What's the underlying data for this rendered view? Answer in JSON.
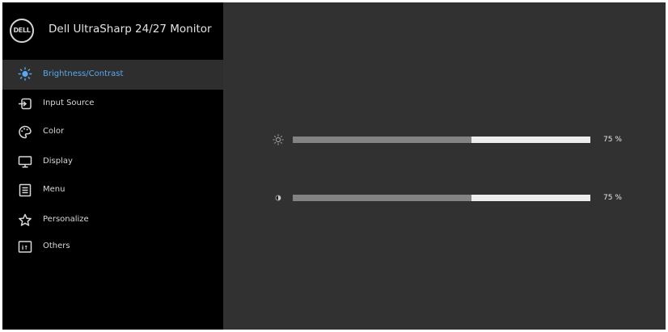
{
  "header": {
    "logo_text": "DELL",
    "title": "Dell UltraSharp 24/27 Monitor"
  },
  "menu": {
    "items": [
      {
        "label": "Brightness/Contrast",
        "icon": "brightness-icon",
        "active": true
      },
      {
        "label": "Input Source",
        "icon": "input-source-icon",
        "active": false
      },
      {
        "label": "Color",
        "icon": "color-palette-icon",
        "active": false
      },
      {
        "label": "Display",
        "icon": "display-icon",
        "active": false
      },
      {
        "label": "Menu",
        "icon": "menu-icon",
        "active": false
      },
      {
        "label": "Personalize",
        "icon": "star-icon",
        "active": false
      },
      {
        "label": "Others",
        "icon": "others-icon",
        "active": false
      }
    ]
  },
  "sliders": {
    "brightness": {
      "value": 75,
      "value_text": "75 %",
      "icon": "brightness-icon"
    },
    "contrast": {
      "value": 75,
      "value_text": "75 %",
      "icon": "contrast-icon"
    }
  },
  "colors": {
    "active_accent": "#5aa8ee",
    "sidebar_bg": "#000000",
    "content_bg": "#313131"
  }
}
